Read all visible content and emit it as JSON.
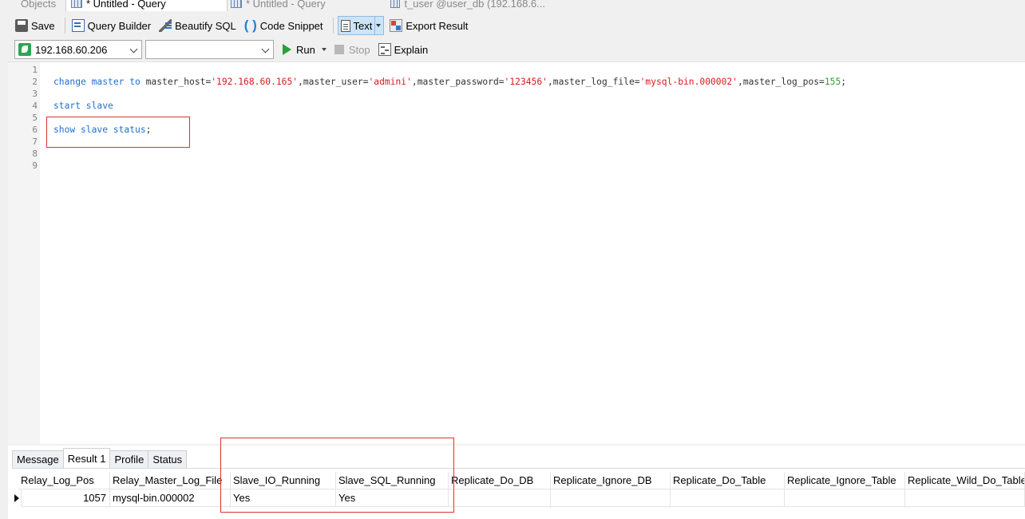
{
  "tabs": [
    {
      "label": "Objects",
      "state": "inactive"
    },
    {
      "label": "* Untitled - Query",
      "state": "active"
    },
    {
      "label": "* Untitled - Query",
      "state": "inactive"
    },
    {
      "label": "t_user @user_db (192.168.6...",
      "state": "inactive"
    }
  ],
  "toolbar": {
    "save": "Save",
    "query_builder": "Query Builder",
    "beautify": "Beautify SQL",
    "snippet": "Code Snippet",
    "text": "Text",
    "export": "Export Result"
  },
  "toolbar2": {
    "connection": "192.168.60.206",
    "database": "",
    "run": "Run",
    "stop": "Stop",
    "explain": "Explain"
  },
  "editor": {
    "line_numbers": [
      "1",
      "2",
      "3",
      "4",
      "5",
      "6",
      "7",
      "8",
      "9"
    ],
    "line2": {
      "kw1": "change master to",
      "p1": " master_host=",
      "s1": "'192.168.60.165'",
      "p2": ",master_user=",
      "s2": "'admini'",
      "p3": ",master_password=",
      "s3": "'123456'",
      "p4": ",master_log_file=",
      "s4": "'mysql-bin.000002'",
      "p5": ",master_log_pos=",
      "n1": "155",
      "end": ";"
    },
    "line4": "start slave",
    "line6_kw": "show slave status",
    "line6_end": ";"
  },
  "results": {
    "tabs": [
      "Message",
      "Result 1",
      "Profile",
      "Status"
    ],
    "active_tab": "Result 1",
    "columns": [
      "Relay_Log_Pos",
      "Relay_Master_Log_File",
      "Slave_IO_Running",
      "Slave_SQL_Running",
      "Replicate_Do_DB",
      "Replicate_Ignore_DB",
      "Replicate_Do_Table",
      "Replicate_Ignore_Table",
      "Replicate_Wild_Do_Table"
    ],
    "row": [
      "1057",
      "mysql-bin.000002",
      "Yes",
      "Yes",
      "",
      "",
      "",
      "",
      ""
    ]
  },
  "colors": {
    "keyword": "#1f6fd1",
    "string": "#d81b1b",
    "number": "#2a9d3a",
    "highlight_box": "#e0312f"
  }
}
